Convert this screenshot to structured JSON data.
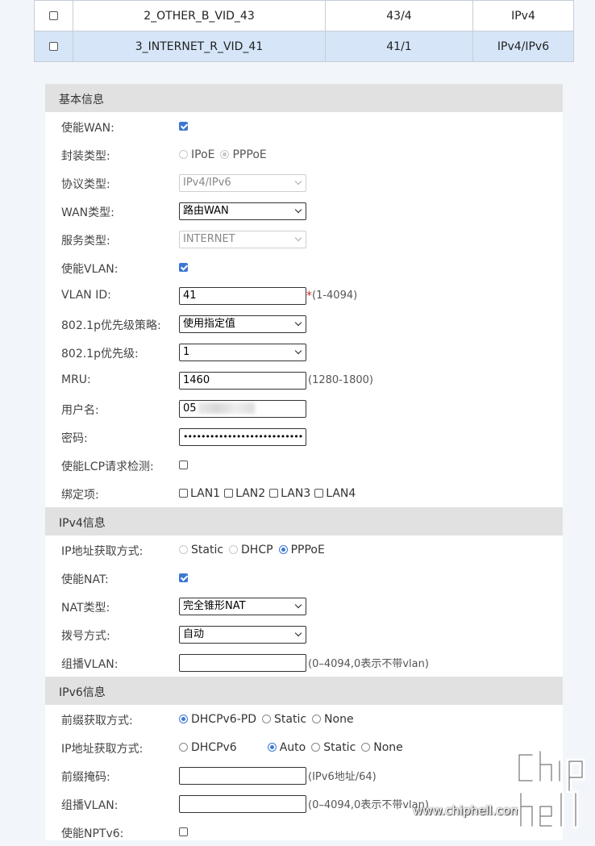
{
  "wan_list": [
    {
      "checked": false,
      "name": "2_OTHER_B_VID_43",
      "vlan": "43/4",
      "protocol": "IPv4",
      "selected": false
    },
    {
      "checked": false,
      "name": "3_INTERNET_R_VID_41",
      "vlan": "41/1",
      "protocol": "IPv4/IPv6",
      "selected": true
    }
  ],
  "basic": {
    "title": "基本信息",
    "enable_wan": {
      "label": "使能WAN:",
      "checked": true
    },
    "encap": {
      "label": "封装类型:",
      "opt1": "IPoE",
      "opt2": "PPPoE",
      "selected": "PPPoE"
    },
    "protocol": {
      "label": "协议类型:",
      "value": "IPv4/IPv6"
    },
    "wan_type": {
      "label": "WAN类型:",
      "value": "路由WAN"
    },
    "service": {
      "label": "服务类型:",
      "value": "INTERNET"
    },
    "enable_vlan": {
      "label": "使能VLAN:",
      "checked": true
    },
    "vlan_id": {
      "label": "VLAN ID:",
      "value": "41",
      "required": "*",
      "hint": "(1-4094)"
    },
    "p8021_policy": {
      "label": "802.1p优先级策略:",
      "value": "使用指定值"
    },
    "p8021": {
      "label": "802.1p优先级:",
      "value": "1"
    },
    "mru": {
      "label": "MRU:",
      "value": "1460",
      "hint": "(1280-1800)"
    },
    "username": {
      "label": "用户名:",
      "value": "05"
    },
    "password": {
      "label": "密码:",
      "value": "•••••••••••••••••••••••••••"
    },
    "lcp": {
      "label": "使能LCP请求检测:",
      "checked": false
    },
    "binding": {
      "label": "绑定项:",
      "lan1": "LAN1",
      "lan2": "LAN2",
      "lan3": "LAN3",
      "lan4": "LAN4"
    }
  },
  "ipv4": {
    "title": "IPv4信息",
    "ip_mode": {
      "label": "IP地址获取方式:",
      "opt1": "Static",
      "opt2": "DHCP",
      "opt3": "PPPoE",
      "selected": "PPPoE"
    },
    "enable_nat": {
      "label": "使能NAT:",
      "checked": true
    },
    "nat_type": {
      "label": "NAT类型:",
      "value": "完全锥形NAT"
    },
    "dial": {
      "label": "拨号方式:",
      "value": "自动"
    },
    "mvlan": {
      "label": "组播VLAN:",
      "value": "",
      "hint": "(0–4094,0表示不带vlan)"
    }
  },
  "ipv6": {
    "title": "IPv6信息",
    "prefix_mode": {
      "label": "前缀获取方式:",
      "opt1": "DHCPv6-PD",
      "opt2": "Static",
      "opt3": "None",
      "selected": "DHCPv6-PD"
    },
    "ip_mode": {
      "label": "IP地址获取方式:",
      "opt1": "DHCPv6",
      "opt2": "Auto",
      "opt3": "Static",
      "opt4": "None",
      "selected": "Auto"
    },
    "prefix_mask": {
      "label": "前缀掩码:",
      "value": "",
      "hint": "(IPv6地址/64)"
    },
    "mvlan": {
      "label": "组播VLAN:",
      "value": "",
      "hint": "(0–4094,0表示不带vlan)"
    },
    "nptv6": {
      "label": "使能NPTv6:",
      "checked": false
    }
  },
  "watermark": {
    "text": "www.chiphell.com",
    "logo": "chip hell"
  },
  "colors": {
    "accent": "#3c77d4",
    "selected_row": "#d6e6f8",
    "section_bg": "#e1e1e1"
  }
}
